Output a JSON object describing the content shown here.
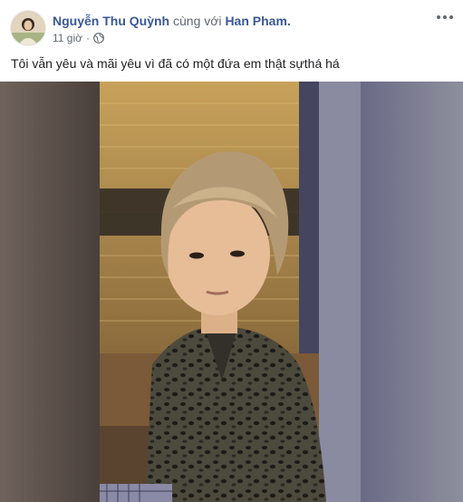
{
  "post": {
    "author": "Nguyễn Thu Quỳnh",
    "with_text": "cùng với",
    "tagged_user": "Han Pham.",
    "time": "11 giờ",
    "separator": "·",
    "privacy_icon": "globe-icon",
    "menu_icon": "more-options-icon",
    "text": "Tôi vẫn yêu và mãi yêu vì đã có một đứa em thật sựthá há"
  },
  "colors": {
    "link": "#385898",
    "meta": "#616770",
    "text": "#1c1e21"
  }
}
